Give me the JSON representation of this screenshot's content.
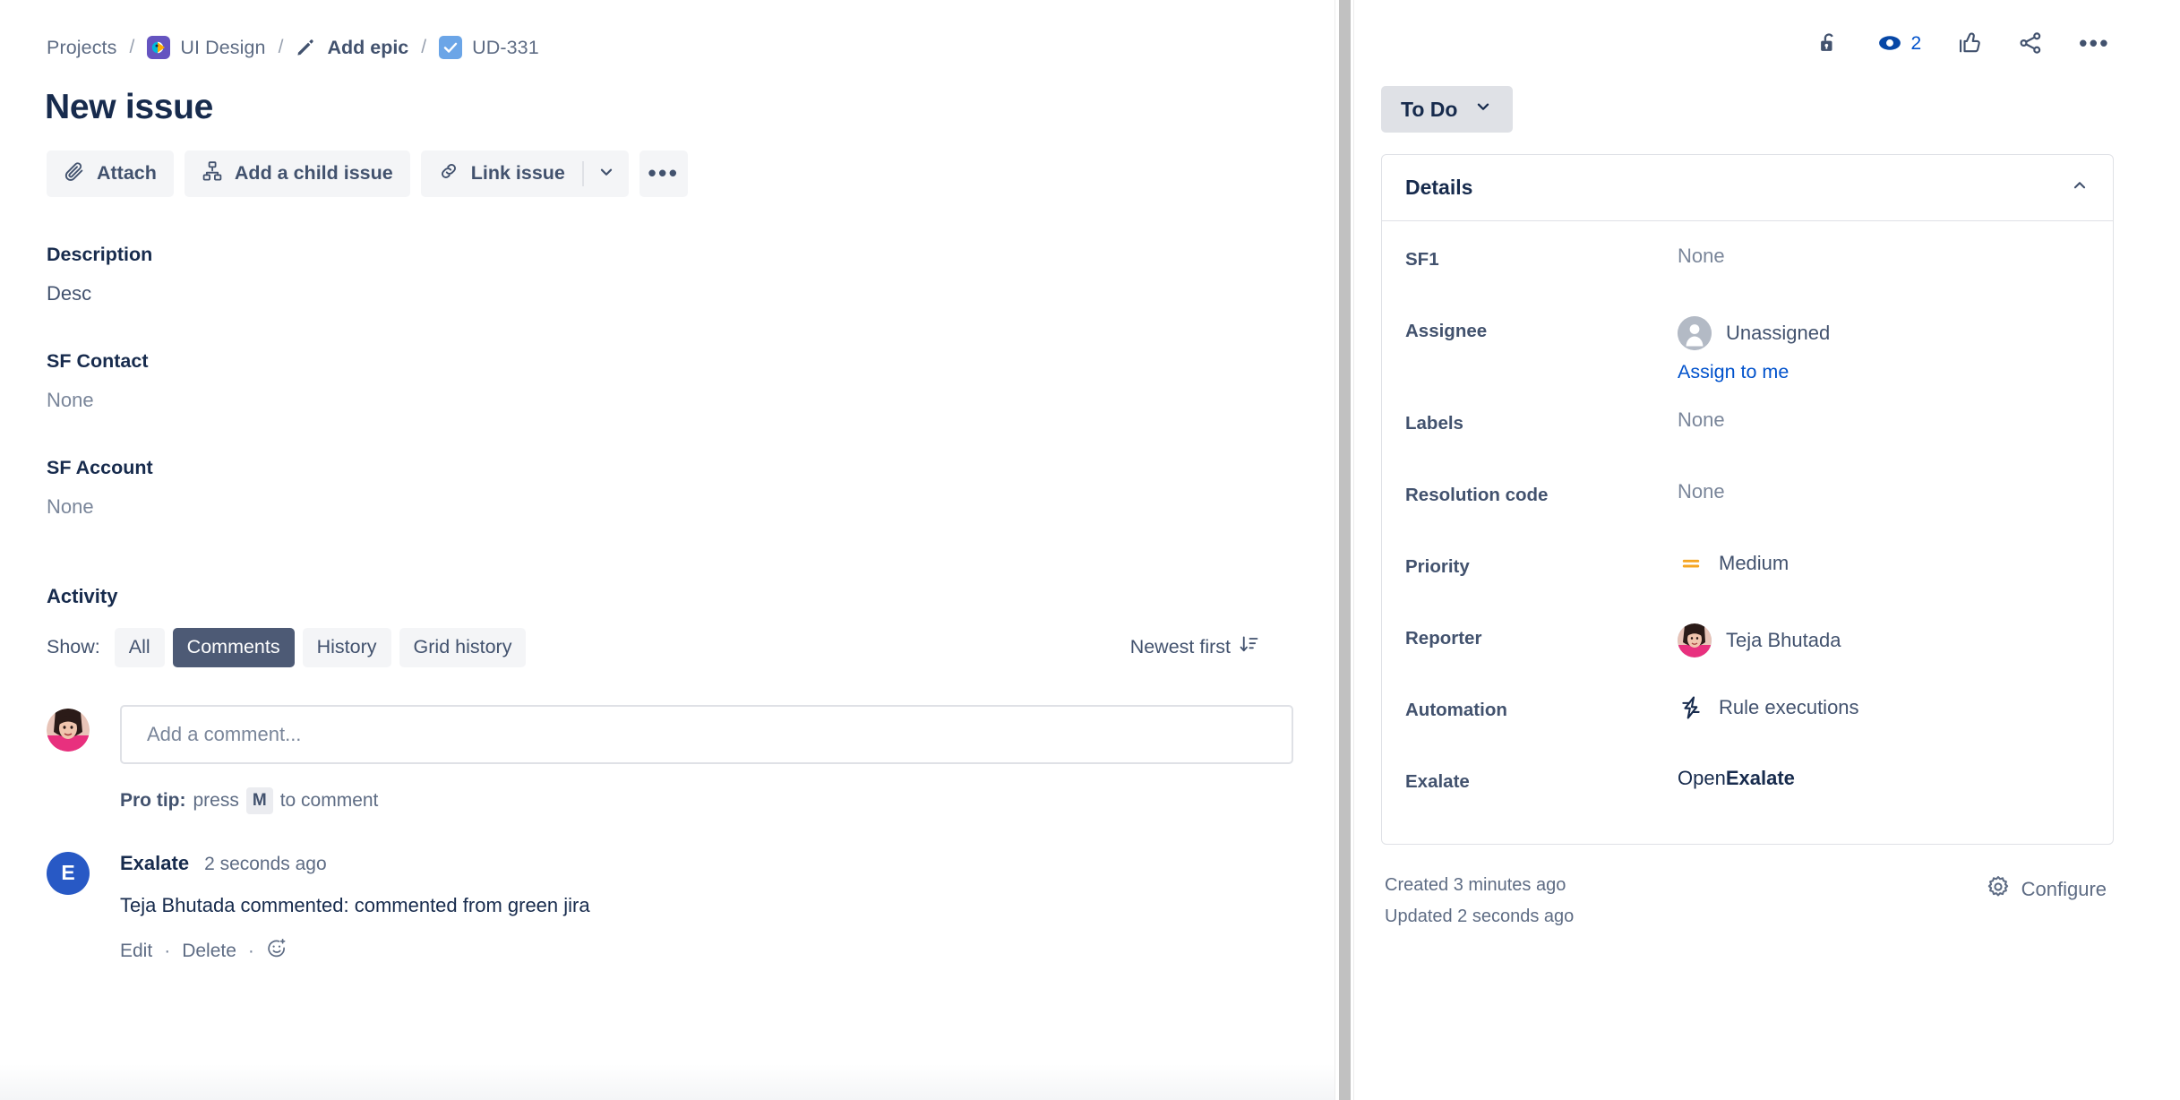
{
  "breadcrumb": {
    "projects": "Projects",
    "project": "UI Design",
    "epic": "Add epic",
    "issue_key": "UD-331",
    "separator": "/"
  },
  "issue": {
    "title": "New issue"
  },
  "toolbar": {
    "attach": "Attach",
    "add_child": "Add a child issue",
    "link_issue": "Link issue",
    "more": "•••"
  },
  "fields": [
    {
      "label": "Description",
      "value": "Desc",
      "is_none": false
    },
    {
      "label": "SF Contact",
      "value": "None",
      "is_none": true
    },
    {
      "label": "SF Account",
      "value": "None",
      "is_none": true
    }
  ],
  "activity": {
    "heading": "Activity",
    "show_label": "Show:",
    "tabs": [
      {
        "label": "All",
        "active": false
      },
      {
        "label": "Comments",
        "active": true
      },
      {
        "label": "History",
        "active": false
      },
      {
        "label": "Grid history",
        "active": false
      }
    ],
    "sort_label": "Newest first",
    "composer_placeholder": "Add a comment...",
    "protip_prefix": "Pro tip:",
    "protip_mid": "press",
    "protip_key": "M",
    "protip_suffix": "to comment",
    "comments": [
      {
        "avatar_initial": "E",
        "author": "Exalate",
        "time": "2 seconds ago",
        "text": "Teja Bhutada commented: commented from green jira",
        "edit": "Edit",
        "delete": "Delete",
        "dot": "·"
      }
    ]
  },
  "header_icons": {
    "lock": "lock-unlocked",
    "watch": "watch-eye",
    "watch_count": "2",
    "like": "thumbs-up",
    "share": "share",
    "more": "more-actions"
  },
  "status": {
    "value": "To Do"
  },
  "details": {
    "title": "Details",
    "rows": [
      {
        "label": "SF1",
        "value": "None",
        "type": "none"
      },
      {
        "label": "Assignee",
        "value": "Unassigned",
        "type": "avatar-person",
        "link": "Assign to me"
      },
      {
        "label": "Labels",
        "value": "None",
        "type": "none"
      },
      {
        "label": "Resolution code",
        "value": "None",
        "type": "none"
      },
      {
        "label": "Priority",
        "value": "Medium",
        "type": "priority"
      },
      {
        "label": "Reporter",
        "value": "Teja Bhutada",
        "type": "avatar-photo"
      },
      {
        "label": "Automation",
        "value": "Rule executions",
        "type": "automation"
      },
      {
        "label": "Exalate",
        "value_prefix": "Open ",
        "value_strong": "Exalate",
        "type": "exalate"
      }
    ]
  },
  "footer": {
    "created": "Created 3 minutes ago",
    "updated": "Updated 2 seconds ago",
    "configure": "Configure"
  },
  "colors": {
    "text_primary": "#172B4D",
    "text_subtle": "#5E6C84",
    "link": "#0052CC",
    "chip_active_bg": "#4D5A75",
    "status_bg": "#DFE1E6",
    "priority_medium": "#F5A623",
    "exalate_avatar": "#2859C5",
    "project_avatar": "#6554C0",
    "task_icon": "#6BA5E7"
  }
}
